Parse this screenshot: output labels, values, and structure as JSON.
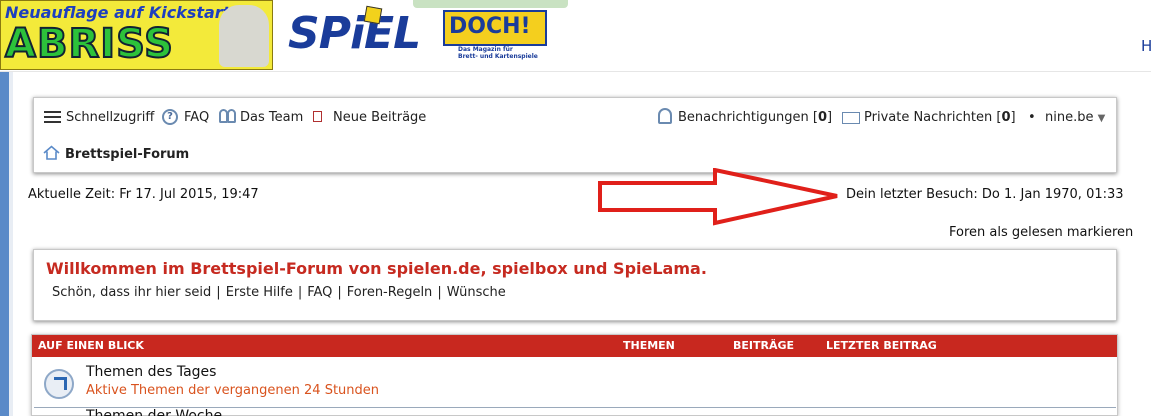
{
  "ad": {
    "tagline": "Neuauflage auf Kickstarter",
    "title": "ABRISS"
  },
  "logo": {
    "spiel": "SPiEL",
    "doch": "DOCH!",
    "subtitle_line1": "Das Magazin für",
    "subtitle_line2": "Brett- und Kartenspiele"
  },
  "cut_letter": "H",
  "navbar": {
    "quick_access": "Schnellzugriff",
    "faq": "FAQ",
    "team": "Das Team",
    "new_posts": "Neue Beiträge",
    "notifications_label": "Benachrichtigungen",
    "notifications_count": "0",
    "private_messages_label": "Private Nachrichten",
    "private_messages_count": "0",
    "bullet": "•",
    "username": "nine.be",
    "username_caret": "▼"
  },
  "breadcrumb": {
    "home": "Brettspiel-Forum"
  },
  "time": {
    "current": "Aktuelle Zeit: Fr 17. Jul 2015, 19:47",
    "last_visit": "Dein letzter Besuch: Do 1. Jan 1970, 01:33"
  },
  "mark_read": "Foren als gelesen markieren",
  "welcome": {
    "title": "Willkommen im Brettspiel-Forum von spielen.de, spielbox und SpieLama.",
    "intro": "Schön, dass ihr hier seid",
    "links": [
      "Erste Hilfe",
      "FAQ",
      "Foren-Regeln",
      "Wünsche"
    ],
    "separator": "|"
  },
  "forum_table": {
    "header": {
      "section": "AUF EINEN BLICK",
      "topics": "THEMEN",
      "posts": "BEITRÄGE",
      "last_post": "LETZTER BEITRAG"
    },
    "rows": [
      {
        "title": "Themen des Tages",
        "description": "Aktive Themen der vergangenen 24 Stunden"
      },
      {
        "title": "Themen der Woche",
        "description": ""
      }
    ]
  },
  "colors": {
    "accent_red": "#c8281f",
    "link_orange": "#d9531e",
    "left_bar_blue": "#5a8ac8",
    "arrow_red": "#e0201a"
  }
}
